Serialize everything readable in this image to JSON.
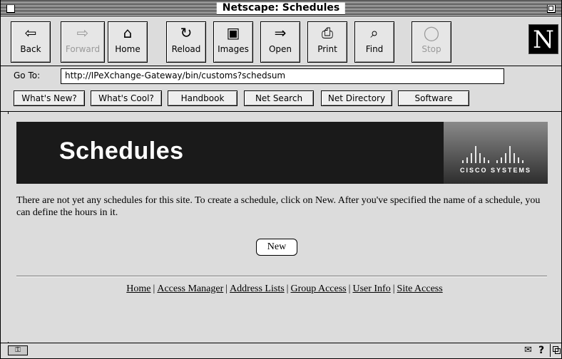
{
  "window": {
    "title": "Netscape: Schedules"
  },
  "toolbar": {
    "buttons": [
      {
        "label": "Back",
        "icon": "back-arrow-icon",
        "glyph": "⇦"
      },
      {
        "label": "Forward",
        "icon": "forward-arrow-icon",
        "glyph": "⇨"
      },
      {
        "label": "Home",
        "icon": "home-icon",
        "glyph": "⌂"
      },
      {
        "label": "Reload",
        "icon": "reload-icon",
        "glyph": "↻"
      },
      {
        "label": "Images",
        "icon": "images-icon",
        "glyph": "▣"
      },
      {
        "label": "Open",
        "icon": "open-icon",
        "glyph": "⇒"
      },
      {
        "label": "Print",
        "icon": "print-icon",
        "glyph": "⎙"
      },
      {
        "label": "Find",
        "icon": "find-icon",
        "glyph": "⌕"
      },
      {
        "label": "Stop",
        "icon": "stop-icon",
        "glyph": "◯"
      }
    ],
    "logo": "N"
  },
  "location": {
    "label": "Go To:",
    "url": "http://IPeXchange-Gateway/bin/customs?schedsum"
  },
  "directory": {
    "buttons": [
      "What's New?",
      "What's Cool?",
      "Handbook",
      "Net Search",
      "Net Directory",
      "Software"
    ]
  },
  "page": {
    "banner_title": "Schedules",
    "brand": "CISCO SYSTEMS",
    "message": "There are not yet any schedules for this site. To create a schedule, click on New. After you've specified the name of a schedule, you can define the hours in it.",
    "new_button": "New",
    "footer_links": [
      "Home",
      "Access Manager",
      "Address Lists",
      "Group Access",
      "User Info",
      "Site Access"
    ],
    "footer_separator": "|"
  }
}
